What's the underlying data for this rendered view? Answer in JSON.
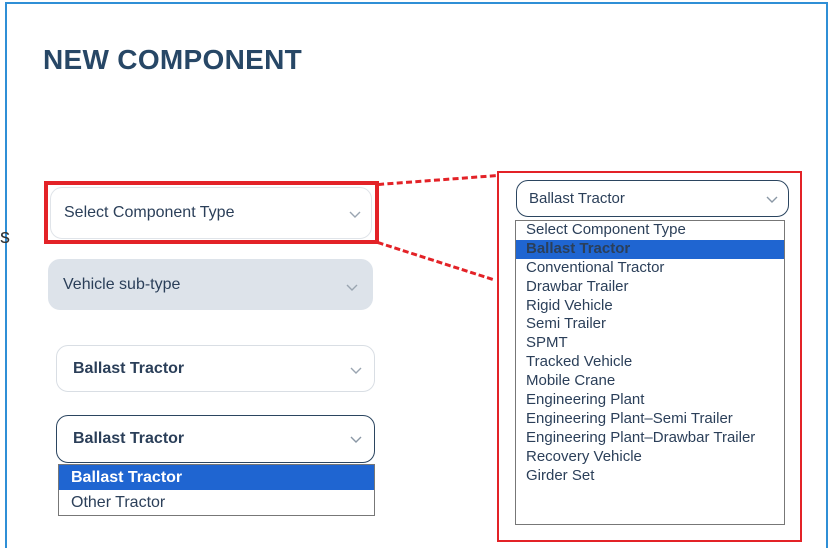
{
  "page": {
    "title": "NEW COMPONENT",
    "stray_char": "s"
  },
  "form": {
    "component_type": {
      "placeholder": "Select Component Type",
      "icon": "chevron-down-icon"
    },
    "vehicle_subtype": {
      "placeholder": "Vehicle sub-type",
      "icon": "chevron-down-icon"
    },
    "example_closed": {
      "value": "Ballast Tractor",
      "icon": "chevron-down-icon"
    },
    "example_open": {
      "value": "Ballast Tractor",
      "icon": "chevron-down-icon",
      "options": [
        "Ballast Tractor",
        "Other Tractor"
      ],
      "selected_index": 0
    }
  },
  "callout": {
    "select": {
      "value": "Ballast Tractor",
      "icon": "chevron-down-icon"
    },
    "options": [
      "Select Component Type",
      "Ballast Tractor",
      "Conventional Tractor",
      "Drawbar Trailer",
      "Rigid Vehicle",
      "Semi Trailer",
      "SPMT",
      "Tracked Vehicle",
      "Mobile Crane",
      "Engineering Plant",
      "Engineering Plant–Semi Trailer",
      "Engineering Plant–Drawbar Trailer",
      "Recovery Vehicle",
      "Girder Set"
    ],
    "selected_index": 1
  },
  "colors": {
    "frame": "#2f8fd6",
    "highlight": "#e32227",
    "selected_bg": "#1f65d1",
    "title": "#274766",
    "text": "#2b3f59",
    "disabled_bg": "#dde3ea"
  }
}
